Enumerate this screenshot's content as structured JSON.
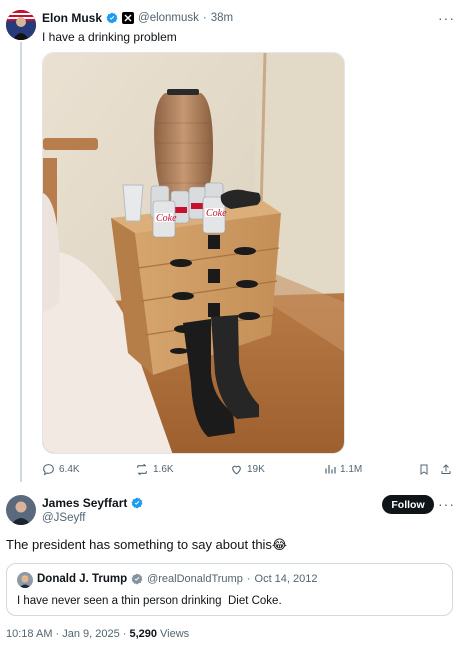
{
  "main_post": {
    "author_name": "Elon Musk",
    "handle": "@elonmusk",
    "dot": "·",
    "time": "38m",
    "text": "I have a drinking problem",
    "image_alt": "Bedside table with Diet Coke cans, a glass, a vase and black boots",
    "can_text": "Coke",
    "actions": {
      "replies": "6.4K",
      "reposts": "1.6K",
      "likes": "19K",
      "views": "1.1M"
    }
  },
  "reply": {
    "author_name": "James Seyffart",
    "handle": "@JSeyff",
    "follow_label": "Follow",
    "text": "The president has something to say about this😂",
    "quote": {
      "author_name": "Donald J. Trump",
      "handle": "@realDonaldTrump",
      "dot": "·",
      "date": "Oct 14, 2012",
      "text": "I have never seen a thin person drinking  Diet Coke."
    },
    "meta": {
      "time_date": "10:18 AM · Jan 9, 2025 ·",
      "views_count": "5,290",
      "views_label": "Views"
    }
  },
  "colors": {
    "verified_blue": "#1d9bf0",
    "text_primary": "#0f1419",
    "text_muted": "#536471",
    "border": "#cfd9de"
  }
}
